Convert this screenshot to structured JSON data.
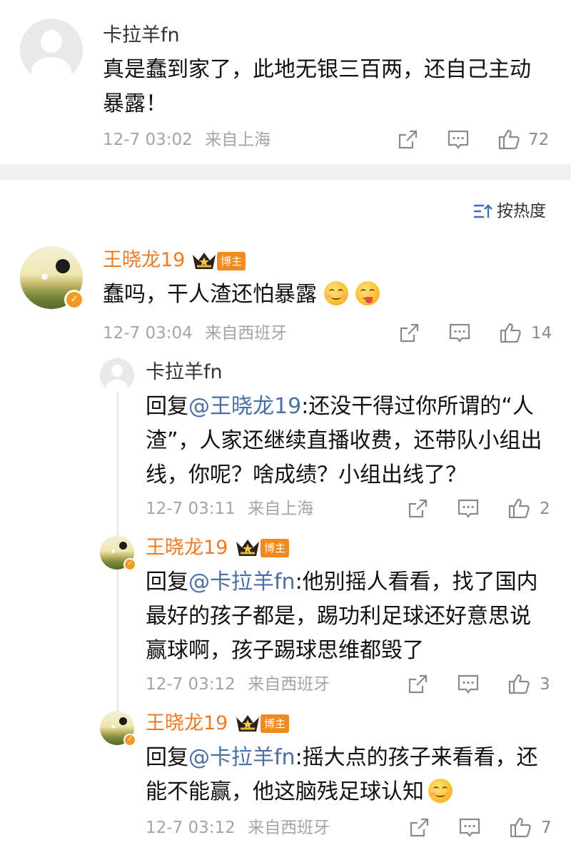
{
  "top_comment": {
    "author": "卡拉羊fn",
    "text_line1": "真是蠢到家了，此地无银三百两，还自己主动",
    "text_line2": "暴露！",
    "time": "12-7 03:02",
    "location": "来自上海",
    "likes": "72"
  },
  "sort": {
    "label": "按热度"
  },
  "main_comment": {
    "author": "王晓龙19",
    "badge": "博主",
    "text": "蠢吗，干人渣还怕暴露",
    "time": "12-7 03:04",
    "location": "来自西班牙",
    "likes": "14"
  },
  "replies": [
    {
      "author": "卡拉羊fn",
      "reply_prefix": "回复",
      "mention": "@王晓龙19",
      "line1": ":还没干得过你所谓的“人",
      "line2": "渣”，人家还继续直播收费，还带队小组出",
      "line3": "线，你呢？啥成绩？小组出线了？",
      "time": "12-7 03:11",
      "location": "来自上海",
      "likes": "2"
    },
    {
      "author": "王晓龙19",
      "badge": "博主",
      "reply_prefix": "回复",
      "mention": "@卡拉羊fn",
      "line1": ":他别摇人看看，找了国内",
      "line2": "最好的孩子都是，踢功利足球还好意思说",
      "line3": "赢球啊，孩子踢球思维都毁了",
      "time": "12-7 03:12",
      "location": "来自西班牙",
      "likes": "3"
    },
    {
      "author": "王晓龙19",
      "badge": "博主",
      "reply_prefix": "回复",
      "mention": "@卡拉羊fn",
      "line1": ":摇大点的孩子来看看，还",
      "line2": "能不能赢，他这脑残足球认知",
      "time": "12-7 03:12",
      "location": "来自西班牙",
      "likes": "7"
    }
  ],
  "icons": [
    "default-avatar",
    "user-avatar",
    "verified-icon",
    "crown-icon",
    "share-icon",
    "comment-icon",
    "like-icon",
    "sort-icon",
    "smile-emoji",
    "wink-emoji"
  ],
  "colors": {
    "author_orange": "#ee7a26",
    "mention_blue": "#4a6fa5",
    "meta_gray": "#a4a4a4",
    "badge_orange": "#f28a1f"
  }
}
